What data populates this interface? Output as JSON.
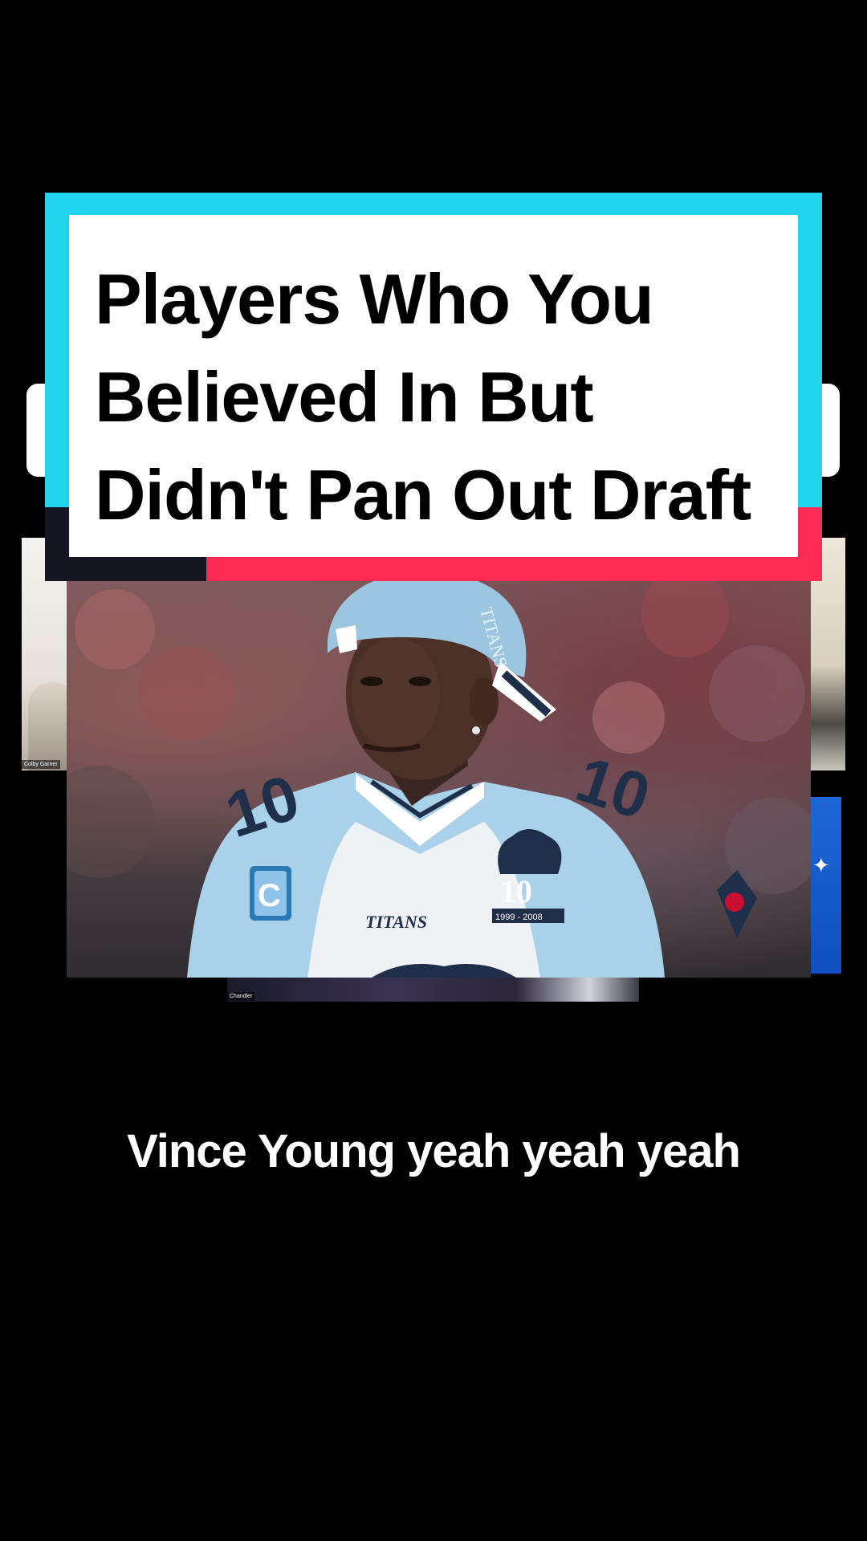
{
  "title_card": {
    "line1": "Players Who You",
    "line2": "Believed In But",
    "line3": "Didn't Pan Out Draft"
  },
  "participants": {
    "left_label": "Colby Garner",
    "bottom_label": "Chandler"
  },
  "photo": {
    "subject": "football player in Titans jersey",
    "jersey_number": "10",
    "jersey_wordmark": "TITANS",
    "captain_patch": "C",
    "anniversary_patch_number": "10",
    "anniversary_patch_years": "1999 - 2008",
    "cap_text": "TITANS"
  },
  "caption": {
    "text": "Vince Young yeah yeah yeah"
  },
  "colors": {
    "cyan": "#22d3ec",
    "red": "#fe2c55",
    "dark": "#161622",
    "background": "#000000"
  }
}
